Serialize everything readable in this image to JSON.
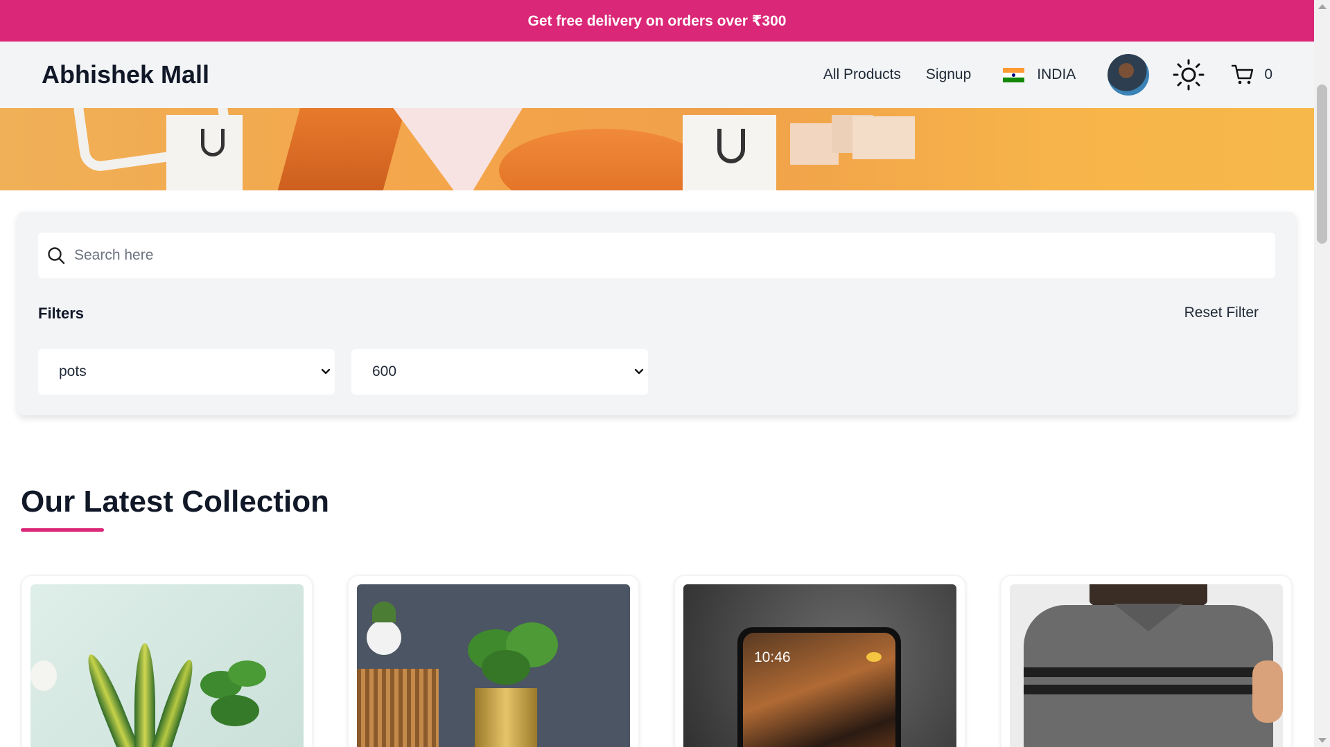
{
  "promo": {
    "text": "Get free delivery on orders over ₹300"
  },
  "header": {
    "brand": "Abhishek Mall",
    "nav": {
      "all_products": "All Products",
      "signup": "Signup"
    },
    "country": "INDIA",
    "cart_count": "0"
  },
  "filters": {
    "search_placeholder": "Search here",
    "title": "Filters",
    "reset_label": "Reset Filter",
    "category_selected": "pots",
    "price_selected": "600"
  },
  "collection": {
    "title": "Our Latest Collection",
    "products": [
      {
        "image": "snake-plant-pots"
      },
      {
        "image": "potted-plant-gold-pot"
      },
      {
        "image": "smartphone-lockscreen"
      },
      {
        "image": "grey-striped-shirt"
      }
    ]
  },
  "colors": {
    "accent": "#db2777",
    "panel": "#f3f4f6"
  },
  "phone_screen": {
    "time": "10:46"
  }
}
